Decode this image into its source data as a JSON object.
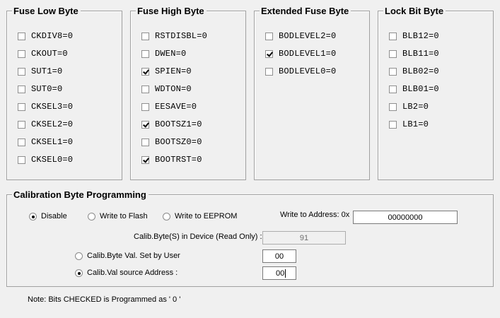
{
  "fuse_low_byte": {
    "title": "Fuse Low Byte",
    "bits": [
      {
        "label": "CKDIV8=0",
        "checked": false
      },
      {
        "label": "CKOUT=0",
        "checked": false
      },
      {
        "label": "SUT1=0",
        "checked": false
      },
      {
        "label": "SUT0=0",
        "checked": false
      },
      {
        "label": "CKSEL3=0",
        "checked": false
      },
      {
        "label": "CKSEL2=0",
        "checked": false
      },
      {
        "label": "CKSEL1=0",
        "checked": false
      },
      {
        "label": "CKSEL0=0",
        "checked": false
      }
    ]
  },
  "fuse_high_byte": {
    "title": "Fuse High Byte",
    "bits": [
      {
        "label": "RSTDISBL=0",
        "checked": false
      },
      {
        "label": "DWEN=0",
        "checked": false
      },
      {
        "label": "SPIEN=0",
        "checked": true
      },
      {
        "label": "WDTON=0",
        "checked": false
      },
      {
        "label": "EESAVE=0",
        "checked": false
      },
      {
        "label": "BOOTSZ1=0",
        "checked": true
      },
      {
        "label": "BOOTSZ0=0",
        "checked": false
      },
      {
        "label": "BOOTRST=0",
        "checked": true
      }
    ]
  },
  "extended_fuse_byte": {
    "title": "Extended Fuse Byte",
    "bits": [
      {
        "label": "BODLEVEL2=0",
        "checked": false
      },
      {
        "label": "BODLEVEL1=0",
        "checked": true
      },
      {
        "label": "BODLEVEL0=0",
        "checked": false
      }
    ]
  },
  "lock_bit_byte": {
    "title": "Lock Bit Byte",
    "bits": [
      {
        "label": "BLB12=0",
        "checked": false
      },
      {
        "label": "BLB11=0",
        "checked": false
      },
      {
        "label": "BLB02=0",
        "checked": false
      },
      {
        "label": "BLB01=0",
        "checked": false
      },
      {
        "label": "LB2=0",
        "checked": false
      },
      {
        "label": "LB1=0",
        "checked": false
      }
    ]
  },
  "calibration": {
    "title": "Calibration Byte Programming",
    "mode_disable": "Disable",
    "mode_flash": "Write to Flash",
    "mode_eeprom": "Write to EEPROM",
    "selected_mode": "Disable",
    "write_address_label": "Write to Address: 0x",
    "write_address_value": "00000000",
    "device_bytes_label": "Calib.Byte(S) in Device (Read Only) :",
    "device_bytes_value": "91",
    "set_by_user_label": "Calib.Byte Val. Set by User",
    "set_by_user_value": "00",
    "source_address_label": "Calib.Val source Address :",
    "source_address_value": "00",
    "selected_source": "source_address"
  },
  "note": "Note: Bits CHECKED is Programmed as ' 0 '"
}
